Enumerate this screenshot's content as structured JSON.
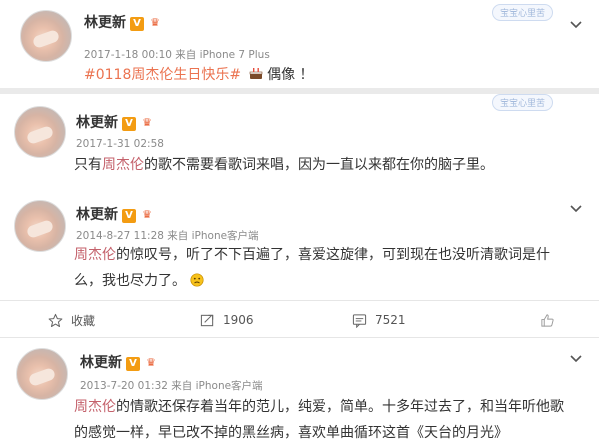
{
  "posts": [
    {
      "author": "林更新",
      "verified_badge": "V",
      "level_icon": "level-icon",
      "meta": "2017-1-18 00:10 来自 iPhone 7 Plus",
      "topic": "#0118周杰伦生日快乐#",
      "emoji_icon": "cake-emoji-icon",
      "text_after": "偶像 ！",
      "stamp": "宝宝心里苦"
    },
    {
      "author": "林更新",
      "verified_badge": "V",
      "meta": "2017-1-31 02:58",
      "text_pre": "只有",
      "text_hl": "周杰伦",
      "text_post": "的歌不需要看歌词来唱，因为一直以来都在你的脑子里。",
      "stamp": "宝宝心里苦"
    },
    {
      "author": "林更新",
      "verified_badge": "V",
      "meta": "2014-8-27 11:28 来自 iPhone客户端",
      "text_hl": "周杰伦",
      "text_line1": "的惊叹号，听了不下百遍了，喜爱这旋律，可到现在也没听清歌词是什",
      "text_line2": "么，我也尽力了。",
      "emoji_icon": "sad-face-emoji-icon"
    },
    {
      "author": "林更新",
      "verified_badge": "V",
      "meta": "2013-7-20 01:32 来自 iPhone客户端",
      "text_hl": "周杰伦",
      "text_line1": "的情歌还保存着当年的范儿，纯爱，简单。十多年过去了，和当年听他歌",
      "text_line2": "的感觉一样，早已改不掉的黑丝病，喜欢单曲循环这首《天台的月光》"
    }
  ],
  "actions": {
    "favorite_label": "收藏",
    "repost_count": "1906",
    "comment_count": "7521",
    "like_icon": "thumbs-up-icon"
  },
  "colors": {
    "highlight": "#c4616b",
    "topic": "#eb7350",
    "verified": "#f39c12"
  }
}
